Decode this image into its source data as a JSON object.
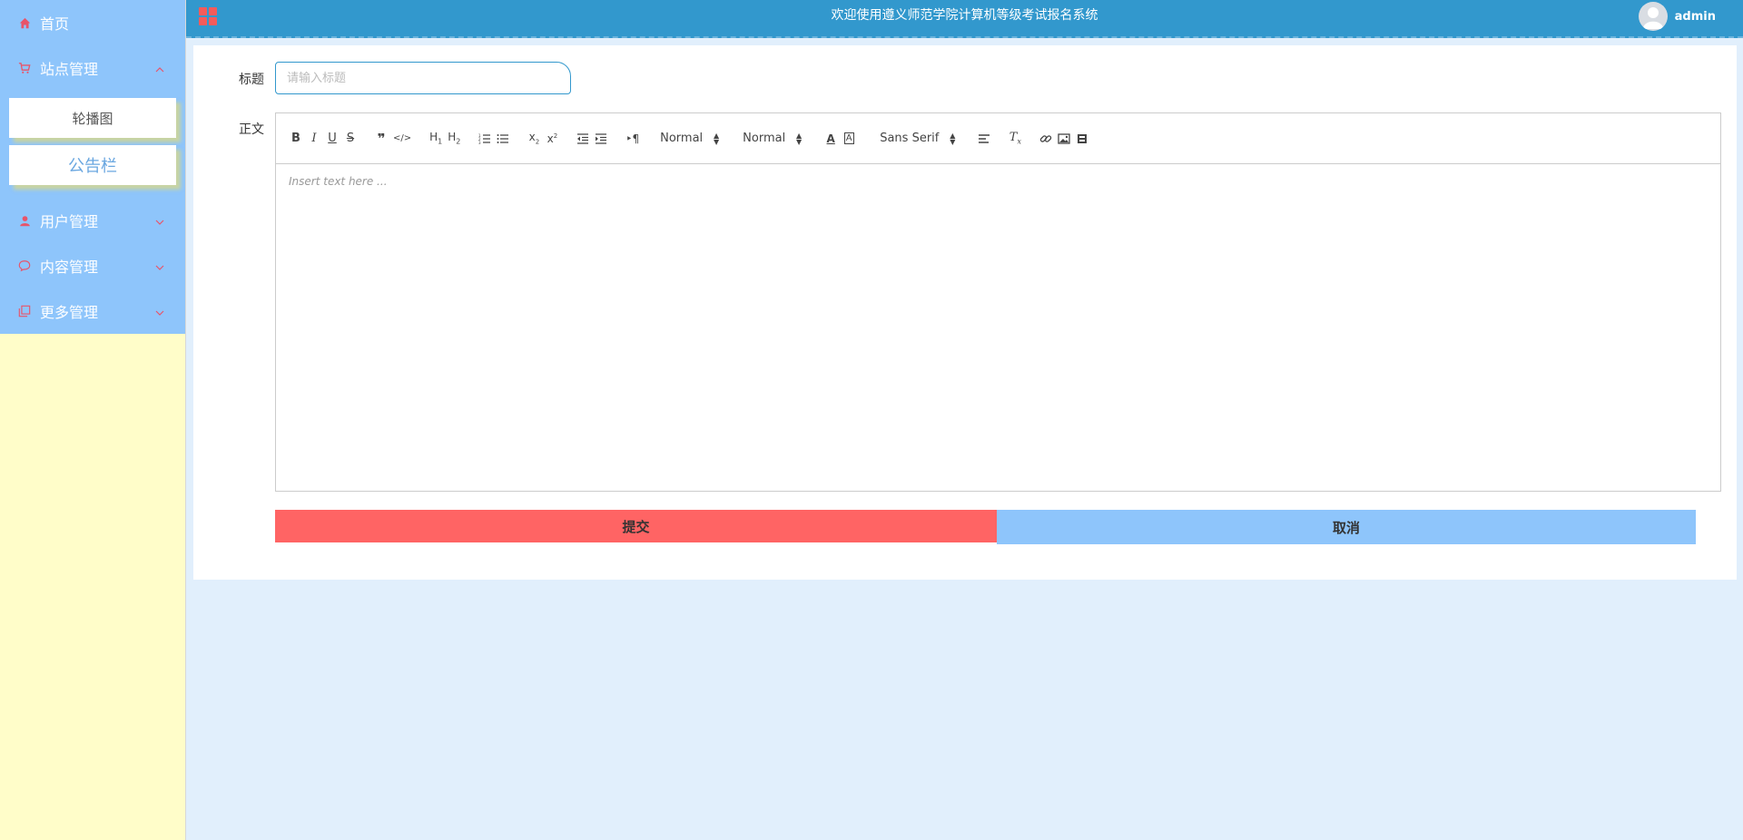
{
  "header": {
    "title": "欢迎使用遵义师范学院计算机等级考试报名系统",
    "username": "admin",
    "accent_color": "#3298cd"
  },
  "sidebar": {
    "items": [
      {
        "label": "首页",
        "icon": "home-icon"
      },
      {
        "label": "站点管理",
        "icon": "cart-icon",
        "expanded": true,
        "children": [
          {
            "label": "轮播图"
          },
          {
            "label": "公告栏",
            "active": true
          }
        ]
      },
      {
        "label": "用户管理",
        "icon": "user-icon"
      },
      {
        "label": "内容管理",
        "icon": "chat-icon"
      },
      {
        "label": "更多管理",
        "icon": "copy-icon"
      }
    ]
  },
  "form": {
    "title_label": "标题",
    "title_placeholder": "请输入标题",
    "title_value": "",
    "body_label": "正文",
    "editor_placeholder": "Insert text here ...",
    "toolbar": {
      "header_select": "Normal",
      "size_select": "Normal",
      "font_select": "Sans Serif"
    },
    "submit_label": "提交",
    "cancel_label": "取消"
  },
  "colors": {
    "sidebar_menu": "#8ec5fb",
    "sidebar_bg": "#fffdc9",
    "submit": "#ff6464",
    "cancel": "#8ec5fb",
    "content_bg": "#e1effc"
  }
}
